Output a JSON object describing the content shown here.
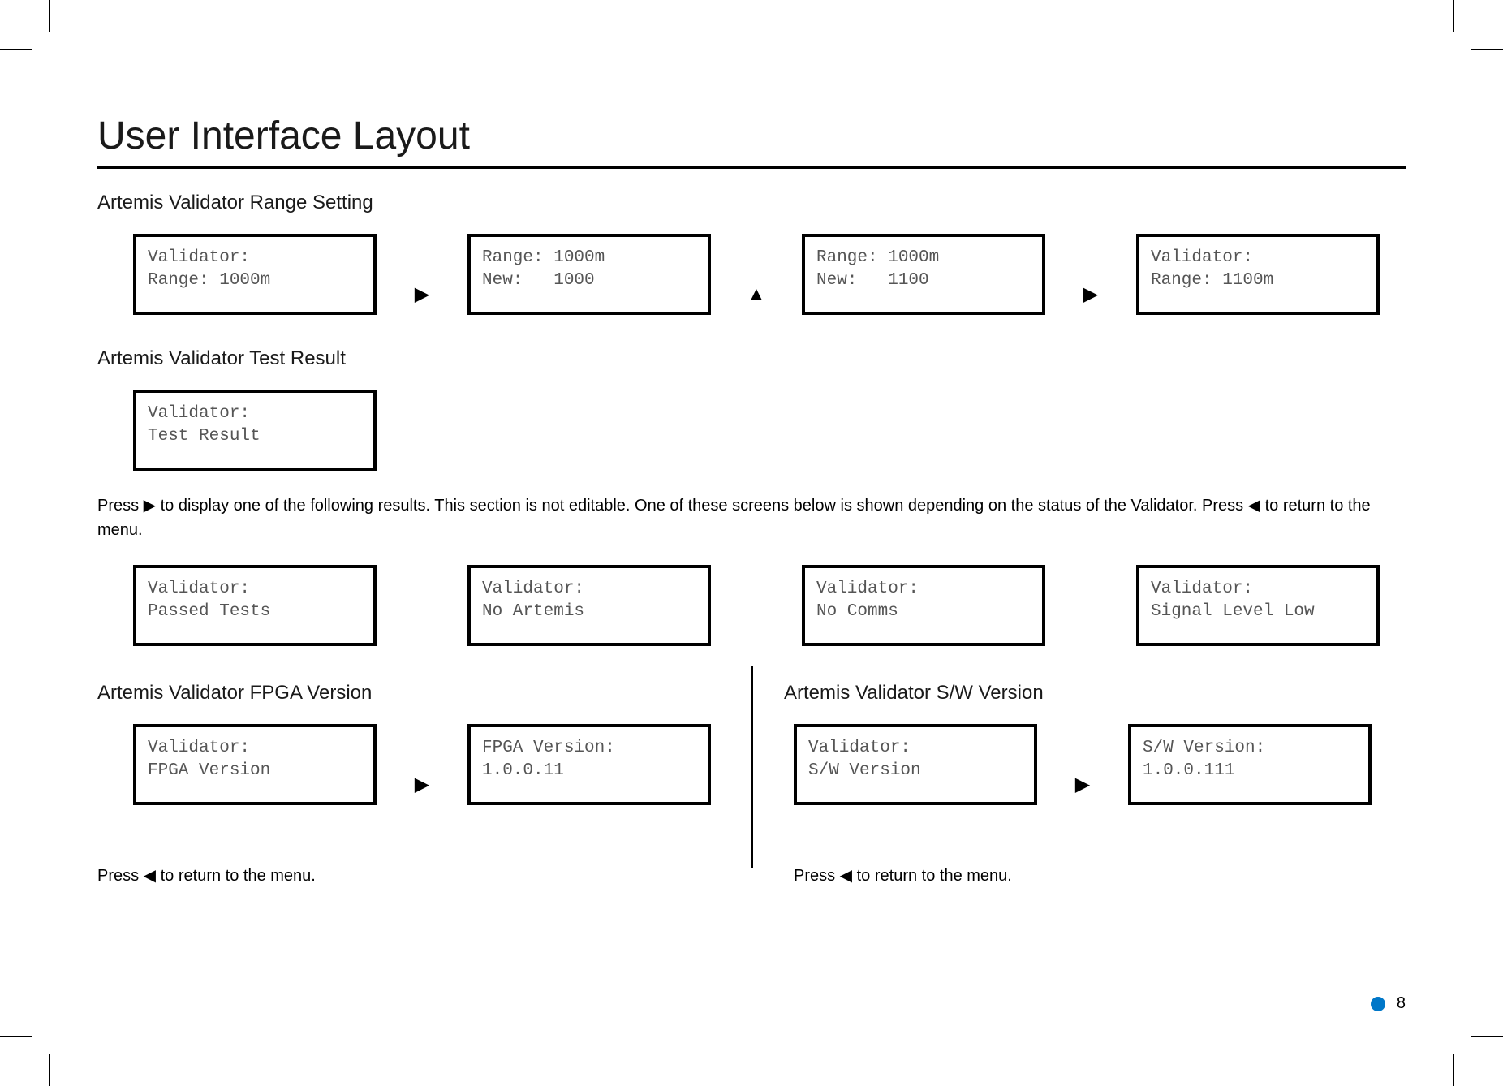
{
  "page_title": "User Interface Layout",
  "page_number": "8",
  "sections": {
    "range_setting": {
      "title": "Artemis Validator Range Setting",
      "screens": [
        "Validator:\nRange: 1000m",
        "Range: 1000m\nNew:   1000",
        "Range: 1000m\nNew:   1100",
        "Validator:\nRange: 1100m"
      ],
      "arrows": [
        "▶",
        "▲",
        "▶"
      ]
    },
    "test_result": {
      "title": "Artemis Validator Test Result",
      "screen_intro": "Validator:\nTest Result",
      "note": "Press ▶ to display one of the following results. This section is not editable. One of these screens below is shown depending on the status of the Validator. Press ◀ to return to the menu.",
      "screens": [
        "Validator:\nPassed Tests",
        "Validator:\nNo Artemis",
        "Validator:\nNo Comms",
        "Validator:\nSignal Level Low"
      ]
    },
    "fpga": {
      "title": "Artemis Validator FPGA Version",
      "screens": [
        "Validator:\nFPGA Version",
        "FPGA Version:\n1.0.0.11"
      ],
      "arrow": "▶",
      "footnote": "Press ◀ to return to the menu."
    },
    "sw": {
      "title": "Artemis Validator S/W Version",
      "screens": [
        "Validator:\nS/W Version",
        "S/W Version:\n1.0.0.111"
      ],
      "arrow": "▶",
      "footnote": "Press ◀ to return to the menu."
    }
  }
}
